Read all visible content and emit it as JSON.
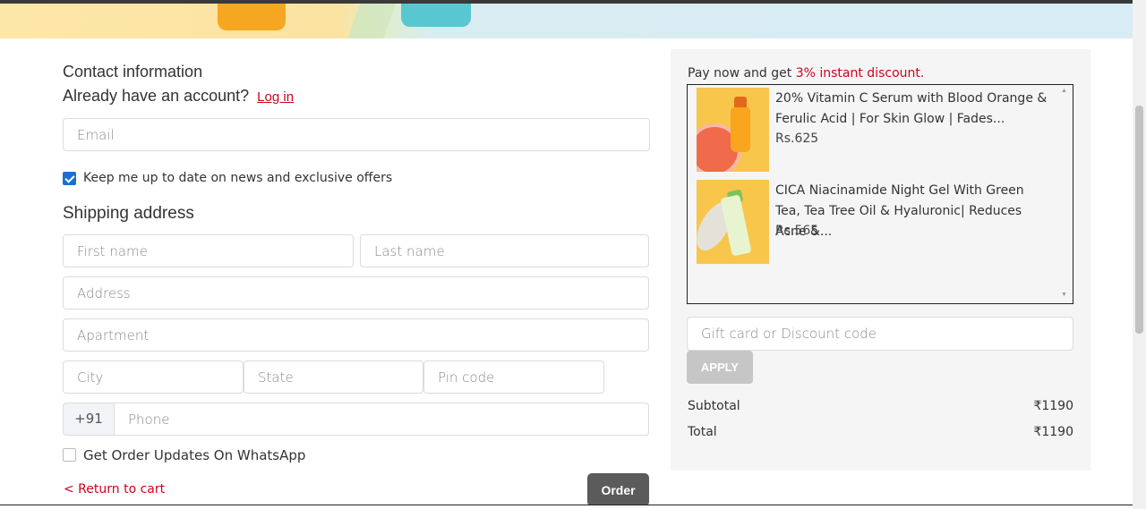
{
  "contact": {
    "heading": "Contact information",
    "account_prompt": "Already have an account?",
    "login_link": "Log in",
    "email_placeholder": "Email",
    "newsletter_label": "Keep me up to date on news and exclusive offers",
    "newsletter_checked": true
  },
  "shipping": {
    "heading": "Shipping address",
    "first_name_placeholder": "First name",
    "last_name_placeholder": "Last name",
    "address_placeholder": "Address",
    "apartment_placeholder": "Apartment",
    "city_placeholder": "City",
    "state_placeholder": "State",
    "pin_placeholder": "Pin code",
    "phone_prefix": "+91",
    "phone_placeholder": "Phone",
    "whatsapp_label": "Get Order Updates On WhatsApp",
    "whatsapp_checked": false
  },
  "actions": {
    "return_link": "< Return to cart",
    "order_button": "Order"
  },
  "summary": {
    "pay_now_prefix": "Pay now and get ",
    "pay_now_discount": "3% instant discount.",
    "products": [
      {
        "title": "20% Vitamin C Serum with Blood Orange & Ferulic Acid | For Skin Glow | Fades...",
        "price": "Rs.625"
      },
      {
        "title": "CICA Niacinamide Night Gel With Green Tea, Tea Tree Oil & Hyaluronic| Reduces Acne &...",
        "price": "Rs.565"
      }
    ],
    "discount_placeholder": "Gift card or Discount code",
    "apply_button": "APPLY",
    "subtotal_label": "Subtotal",
    "subtotal_value": "₹1190",
    "total_label": "Total",
    "total_value": "₹1190"
  },
  "colors": {
    "accent_red": "#d0021b",
    "checkbox_blue": "#1a6fd0",
    "order_button": "#5b5b5b",
    "apply_button": "#c6c6c6"
  }
}
